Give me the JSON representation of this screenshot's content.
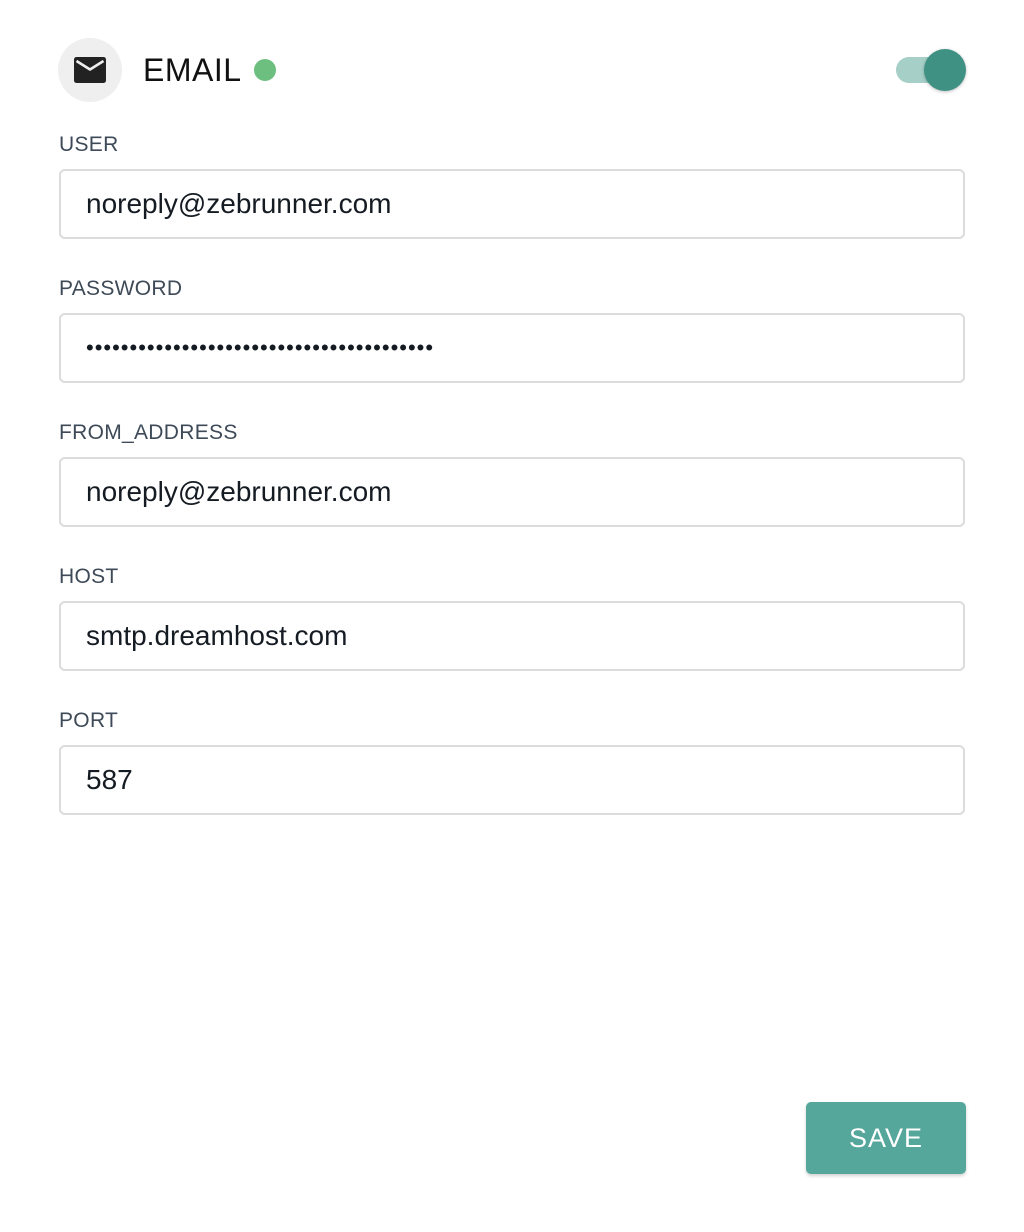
{
  "header": {
    "title": "EMAIL",
    "icon": "mail-icon",
    "status_color": "#6cbf7e",
    "enabled": true,
    "accent_color": "#3f9184"
  },
  "fields": {
    "user": {
      "label": "USER",
      "value": "noreply@zebrunner.com"
    },
    "password": {
      "label": "PASSWORD",
      "value": "••••••••••••••••••••••••••••••••••••••••"
    },
    "from_address": {
      "label": "FROM_ADDRESS",
      "value": "noreply@zebrunner.com"
    },
    "host": {
      "label": "HOST",
      "value": "smtp.dreamhost.com"
    },
    "port": {
      "label": "PORT",
      "value": "587"
    }
  },
  "actions": {
    "save_label": "SAVE",
    "save_color": "#56a79b"
  }
}
